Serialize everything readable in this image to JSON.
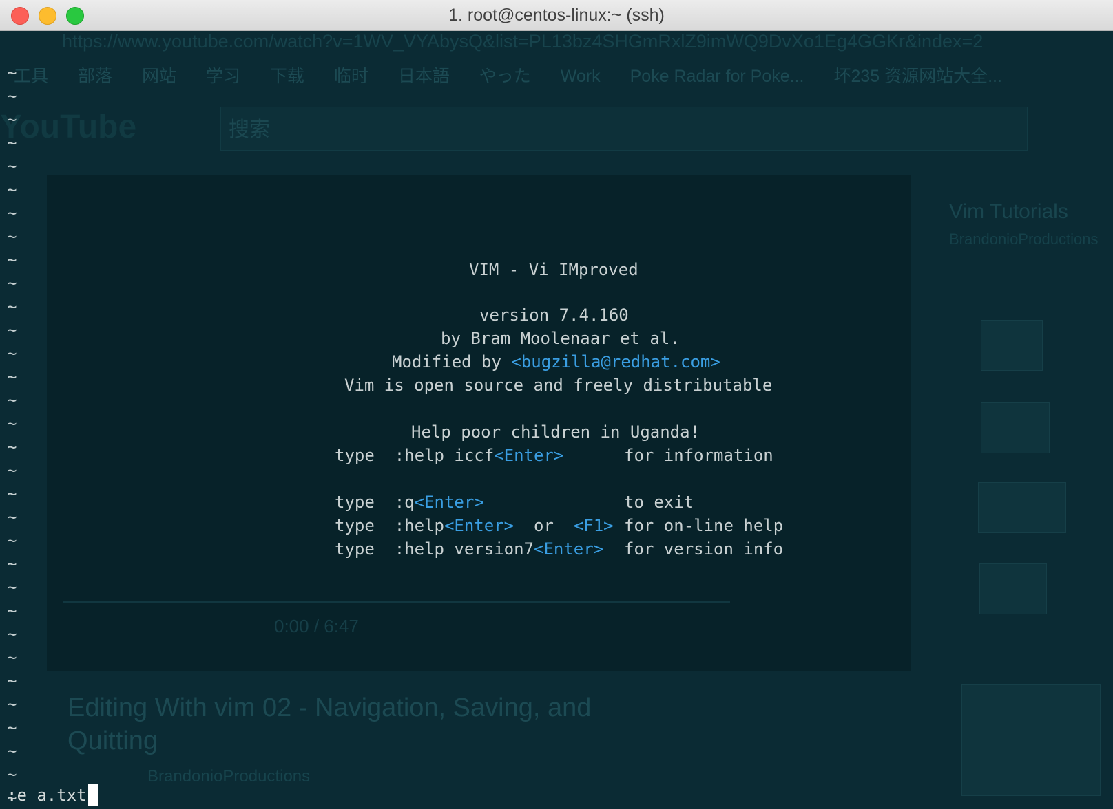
{
  "window": {
    "title": "1. root@centos-linux:~ (ssh)"
  },
  "background_ghost": {
    "url": "https://www.youtube.com/watch?v=1WV_VYAbysQ&list=PL13bz4SHGmRxlZ9imWQ9DvXo1Eg4GGKr&index=2",
    "bookmarks": [
      "工具",
      "部落",
      "网站",
      "学习",
      "下载",
      "临时",
      "日本語",
      "やった",
      "Work",
      "Poke Radar for Poke...",
      "坏235 资源网站大全..."
    ],
    "logo": "YouTube",
    "search_placeholder": "搜索",
    "playlist_title": "Vim Tutorials",
    "playlist_channel": "BrandonioProductions",
    "player_time": "0:00 / 6:47",
    "video_title_line1": "Editing With vim 02 - Navigation, Saving, and",
    "video_title_line2": "Quitting",
    "channel": "BrandonioProductions"
  },
  "vim": {
    "tilde": "~",
    "tilde_count": 32,
    "splash": {
      "title": "VIM - Vi IMproved",
      "version": "version 7.4.160",
      "author": "by Bram Moolenaar et al.",
      "modified_prefix": "Modified by ",
      "modified_email": "<bugzilla@redhat.com>",
      "license": "Vim is open source and freely distributable",
      "charity": "Help poor children in Uganda!",
      "help_iccf": {
        "type": "type",
        "cmd": ":help iccf",
        "key": "<Enter>",
        "desc": "for information"
      },
      "quit": {
        "type": "type",
        "cmd": ":q",
        "key": "<Enter>",
        "desc": "to exit"
      },
      "help": {
        "type": "type",
        "cmd": ":help",
        "key": "<Enter>",
        "or": "or",
        "key2": "<F1>",
        "desc": "for on-line help"
      },
      "version7": {
        "type": "type",
        "cmd": ":help version7",
        "key": "<Enter>",
        "desc": "for version info"
      }
    },
    "command_line": ":e a.txt"
  }
}
